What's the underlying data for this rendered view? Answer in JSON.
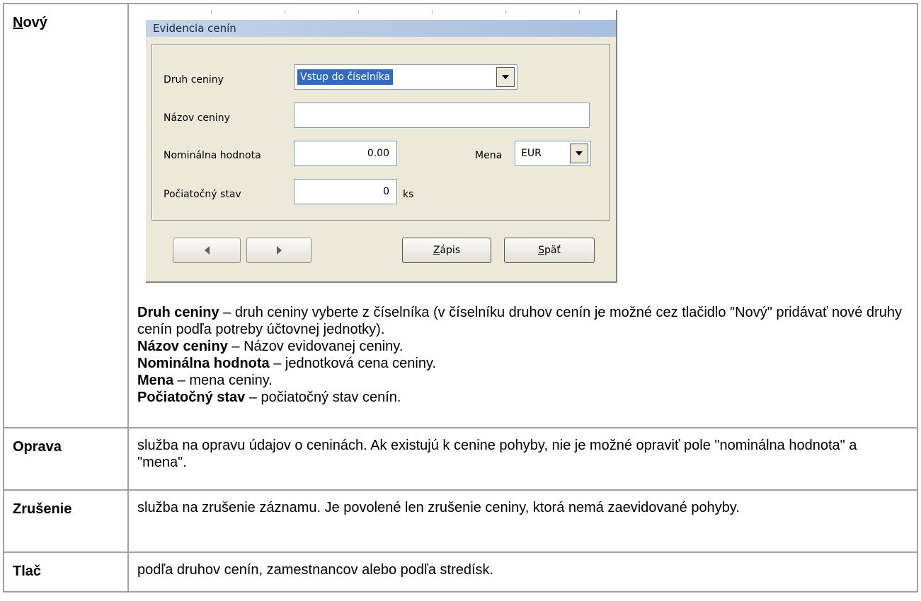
{
  "rows": [
    {
      "term": "Nový",
      "term_underline": "N",
      "term_rest": "ový"
    },
    {
      "term": "Oprava",
      "text": "služba na opravu údajov o ceninách. Ak existujú k cenine pohyby, nie je možné opraviť pole \"nominálna hodnota\" a \"mena\"."
    },
    {
      "term": "Zrušenie",
      "text": "služba na zrušenie záznamu. Je povolené len zrušenie ceniny, ktorá nemá zaevidované pohyby."
    },
    {
      "term": "Tlač",
      "text": "podľa druhov cenín, zamestnancov alebo podľa stredísk."
    }
  ],
  "dialog": {
    "title": "Evidencia cenín",
    "druh_label": "Druh ceniny",
    "druh_value": "Vstup do číselníka",
    "nazov_label": "Názov ceniny",
    "nazov_value": "",
    "nominal_label": "Nominálna hodnota",
    "nominal_value": "0.00",
    "mena_label": "Mena",
    "mena_value": "EUR",
    "stav_label": "Počiatočný stav",
    "stav_value": "0",
    "stav_unit": "ks",
    "zapis_underline": "Z",
    "zapis_rest": "ápis",
    "spat_underline": "S",
    "spat_rest": "päť"
  },
  "definitions": [
    {
      "term": "Druh ceniny",
      "text": " – druh ceniny vyberte z číselníka (v číselníku druhov cenín je možné cez tlačidlo \"Nový\" pridávať nové druhy cenín podľa potreby účtovnej jednotky)."
    },
    {
      "term": "Názov ceniny",
      "text": " – Názov evidovanej ceniny."
    },
    {
      "term": "Nominálna hodnota",
      "text": " – jednotková cena ceniny."
    },
    {
      "term": "Mena",
      "text": " – mena ceniny."
    },
    {
      "term": "Počiatočný stav",
      "text": " – počiatočný stav cenín."
    }
  ]
}
